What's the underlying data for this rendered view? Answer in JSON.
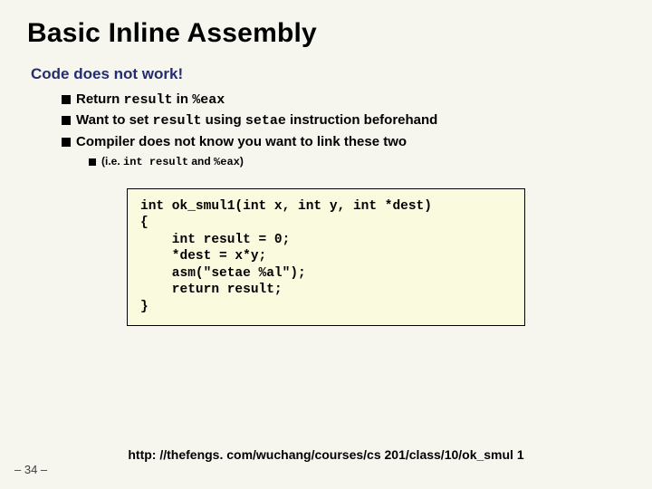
{
  "title": "Basic Inline Assembly",
  "subhead": "Code does not work!",
  "bullets": {
    "b1a": "Return ",
    "b1b": "result",
    "b1c": " in ",
    "b1d": "%eax",
    "b2a": "Want to set ",
    "b2b": "result",
    "b2c": " using ",
    "b2d": "setae",
    "b2e": " instruction beforehand",
    "b3": "Compiler does not know you want to link these two",
    "sb1a": "(i.e. ",
    "sb1b": "int result",
    "sb1c": " and ",
    "sb1d": "%eax",
    "sb1e": ")"
  },
  "code": "int ok_smul1(int x, int y, int *dest)\n{\n    int result = 0;\n    *dest = x*y;\n    asm(\"setae %al\");\n    return result;\n}",
  "footer_link": "http: //thefengs. com/wuchang/courses/cs 201/class/10/ok_smul 1",
  "page_num": "– 34 –"
}
